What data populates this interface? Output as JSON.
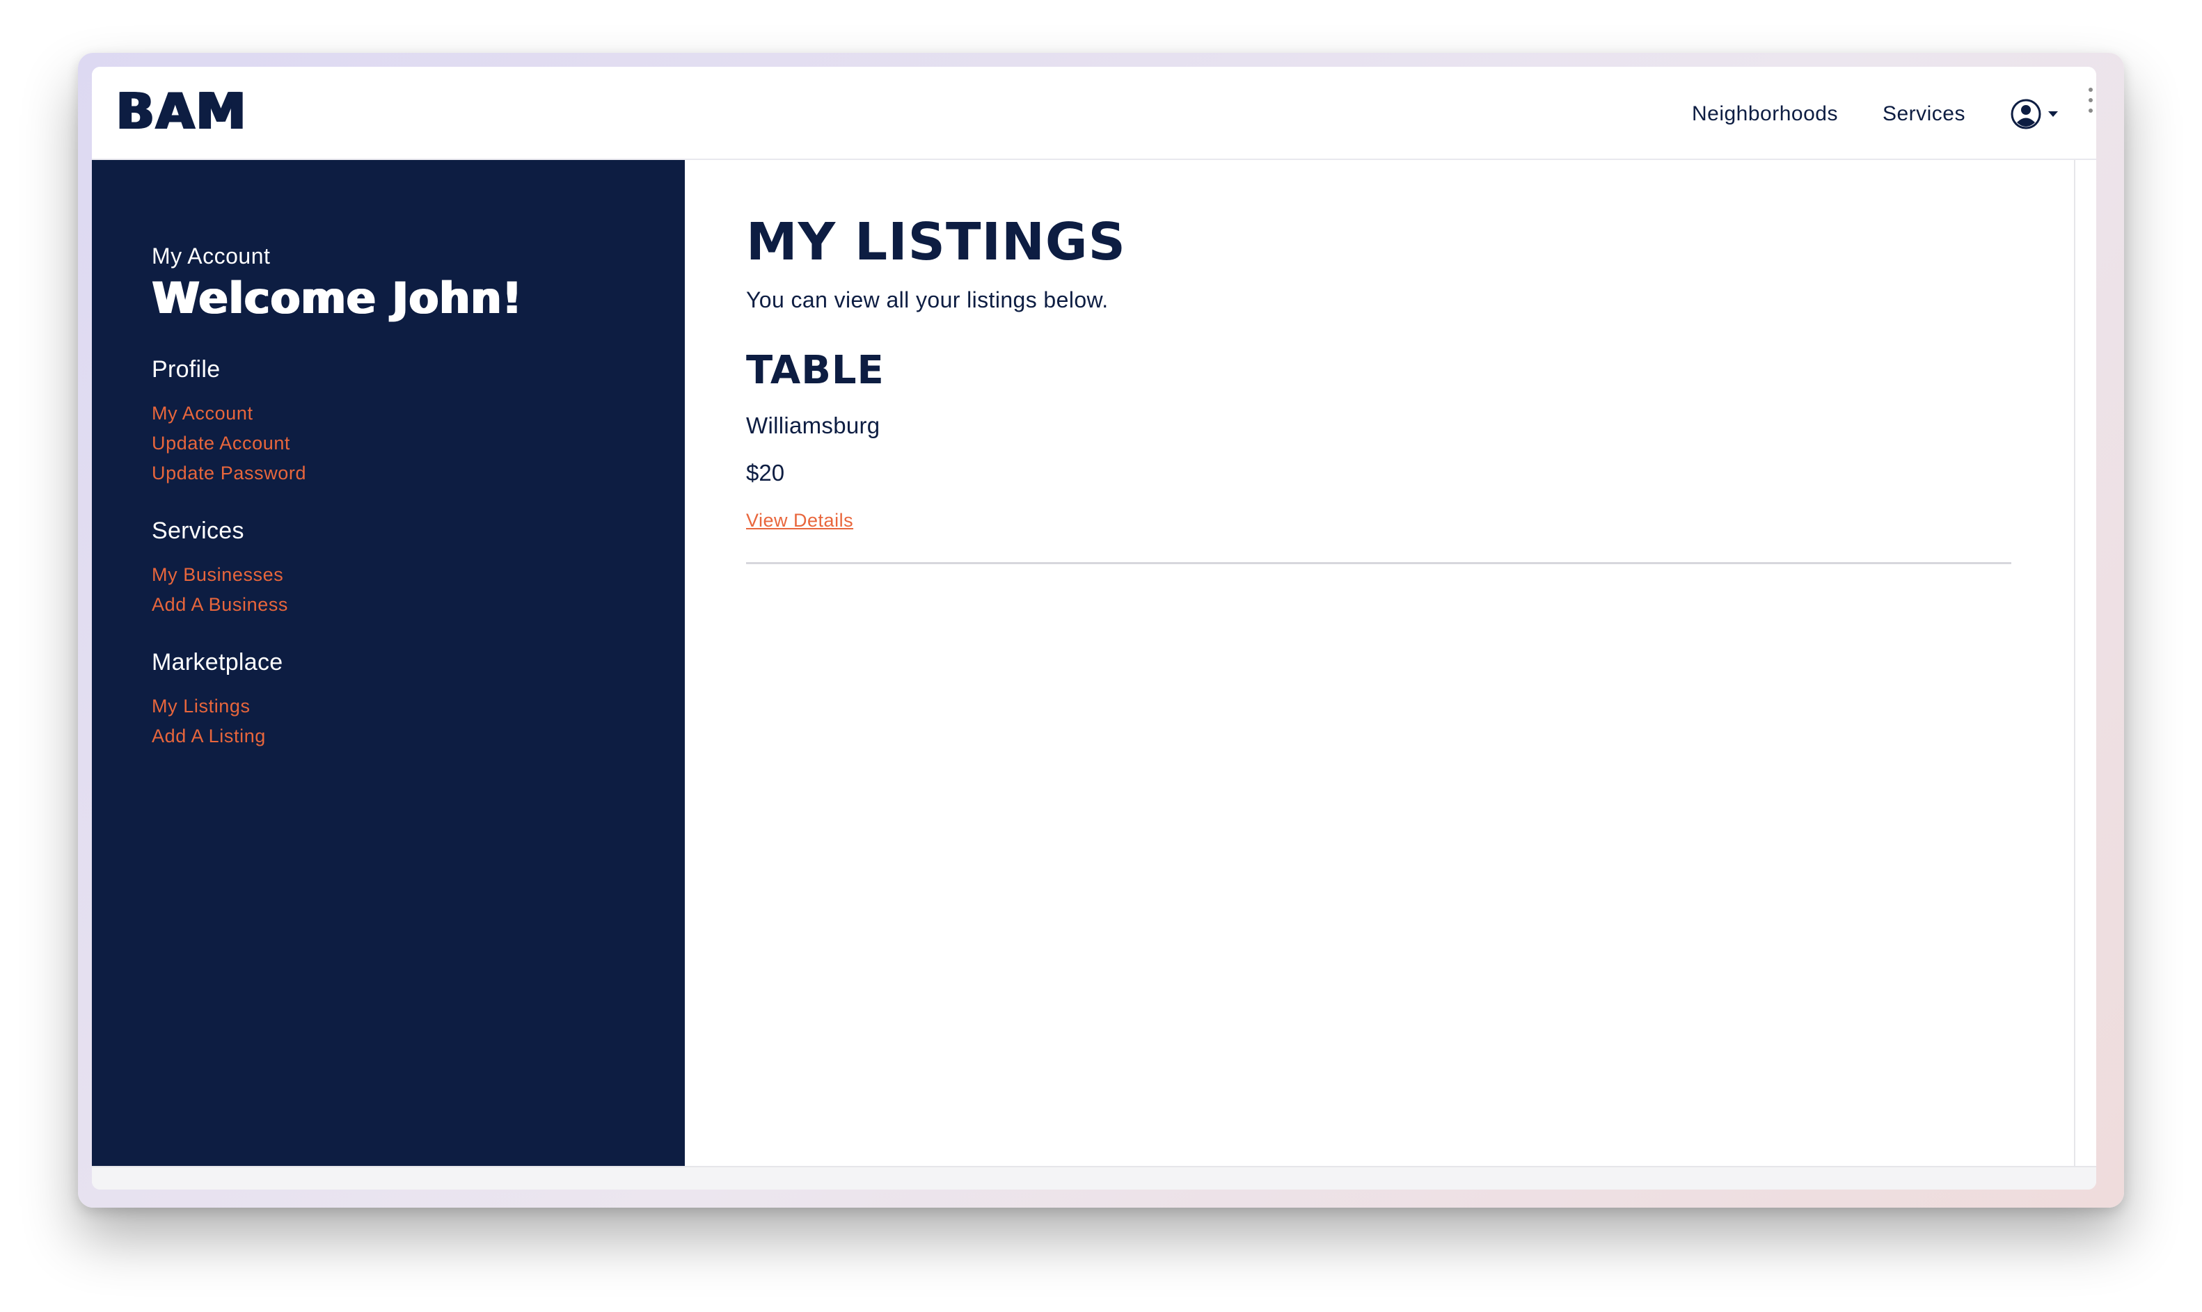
{
  "brand": {
    "logo_text": "BAM"
  },
  "nav": {
    "links": [
      "Neighborhoods",
      "Services"
    ],
    "user_icon": "user-circle-icon",
    "dropdown_icon": "caret-down-icon"
  },
  "sidebar": {
    "kicker": "My Account",
    "welcome": "Welcome John!",
    "sections": [
      {
        "heading": "Profile",
        "links": [
          "My Account",
          "Update Account",
          "Update Password"
        ]
      },
      {
        "heading": "Services",
        "links": [
          "My Businesses",
          "Add A Business"
        ]
      },
      {
        "heading": "Marketplace",
        "links": [
          "My Listings",
          "Add A Listing"
        ]
      }
    ]
  },
  "main": {
    "title": "MY LISTINGS",
    "subtitle": "You can view all your listings below.",
    "listings": [
      {
        "title": "TABLE",
        "location": "Williamsburg",
        "price": "$20",
        "link": "View Details"
      }
    ]
  },
  "colors": {
    "navy": "#0d1d42",
    "accent": "#e8663c",
    "background": "#ffffff",
    "divider": "#d7d7dc"
  }
}
